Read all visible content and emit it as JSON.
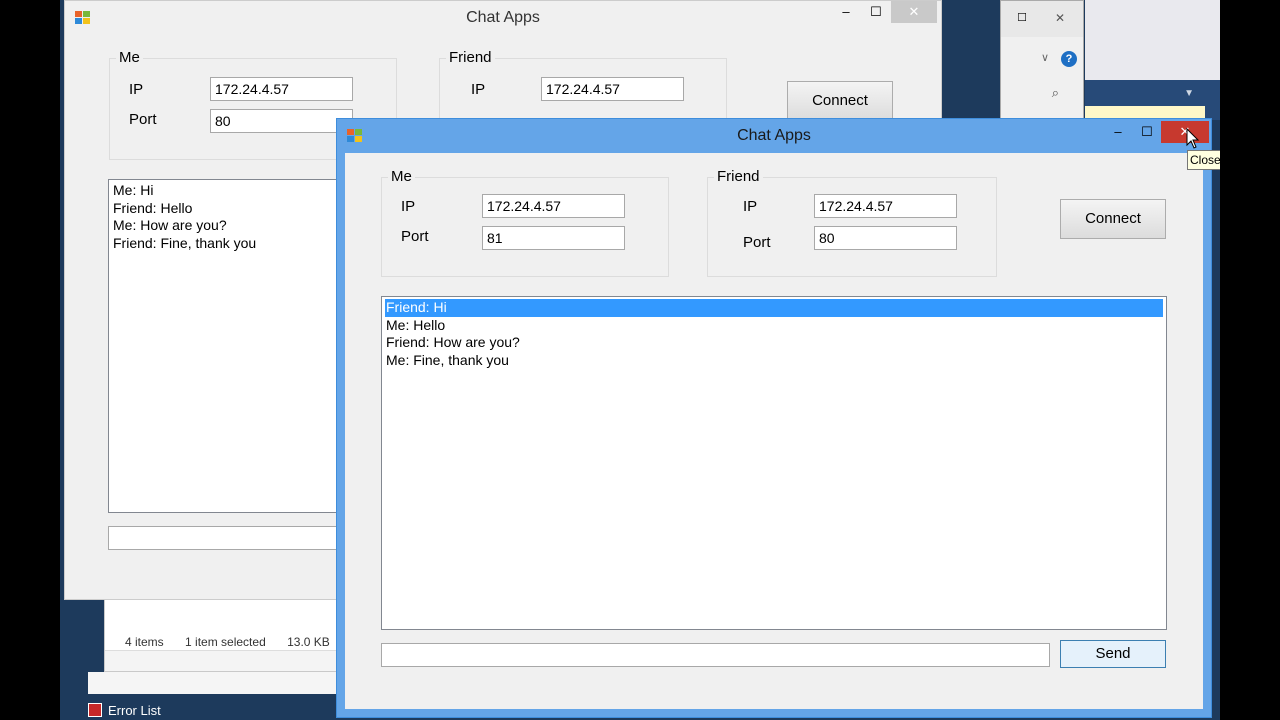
{
  "back_window": {
    "title": "Chat Apps",
    "me": {
      "group_label": "Me",
      "ip_label": "IP",
      "ip_value": "172.24.4.57",
      "port_label": "Port",
      "port_value": "80"
    },
    "friend": {
      "group_label": "Friend",
      "ip_label": "IP",
      "ip_value": "172.24.4.57"
    },
    "connect_label": "Connect",
    "messages": [
      "Me: Hi",
      "Friend: Hello",
      "Me: How are you?",
      "Friend: Fine, thank you"
    ]
  },
  "front_window": {
    "title": "Chat Apps",
    "me": {
      "group_label": "Me",
      "ip_label": "IP",
      "ip_value": "172.24.4.57",
      "port_label": "Port",
      "port_value": "81"
    },
    "friend": {
      "group_label": "Friend",
      "ip_label": "IP",
      "ip_value": "172.24.4.57",
      "port_label": "Port",
      "port_value": "80"
    },
    "connect_label": "Connect",
    "messages": [
      "Friend: Hi",
      "Me: Hello",
      "Friend: How are you?",
      "Me: Fine, thank you"
    ],
    "selected_message_index": 0,
    "message_input_value": "",
    "send_label": "Send",
    "close_tooltip": "Close"
  },
  "explorer_status": {
    "items": "4 items",
    "selected": "1 item selected",
    "size": "13.0 KB"
  },
  "taskbar": {
    "error_list_label": "Error List"
  },
  "colors": {
    "title_active": "#64a5e8",
    "close_button": "#c7392e",
    "selection": "#3399ff"
  }
}
